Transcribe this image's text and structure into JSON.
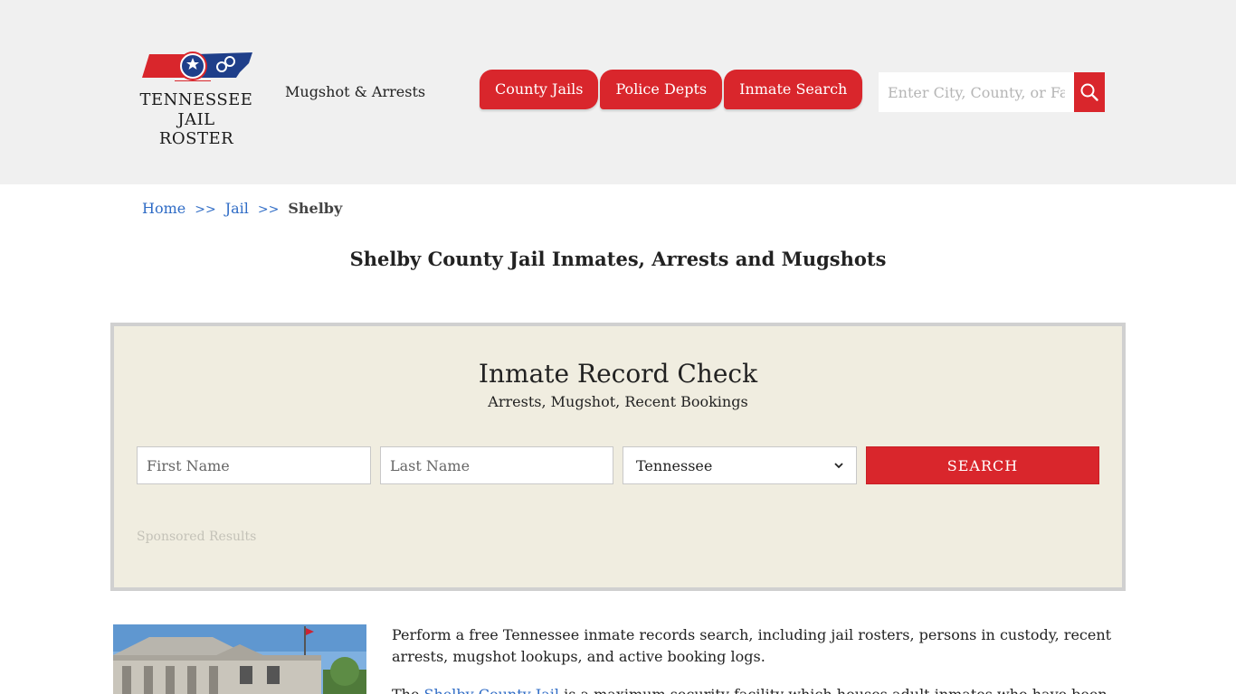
{
  "header": {
    "logo": {
      "line1": "TENNESSEE",
      "line2": "JAIL ROSTER",
      "icon": "tennessee-map-logo"
    },
    "tagline": "Mugshot & Arrests",
    "nav": [
      {
        "label": "County Jails"
      },
      {
        "label": "Police Depts"
      },
      {
        "label": "Inmate Search"
      }
    ],
    "search": {
      "placeholder": "Enter City, County, or Facil",
      "icon": "search-icon"
    }
  },
  "breadcrumb": {
    "home": "Home",
    "sep": ">>",
    "jail": "Jail",
    "current": "Shelby"
  },
  "page_title": "Shelby County Jail Inmates, Arrests and Mugshots",
  "record_check": {
    "title": "Inmate Record Check",
    "subtitle": "Arrests, Mugshot, Recent Bookings",
    "first_name_placeholder": "First Name",
    "last_name_placeholder": "Last Name",
    "state_selected": "Tennessee",
    "search_label": "SEARCH",
    "sponsored": "Sponsored Results"
  },
  "content": {
    "intro": "Perform a free Tennessee inmate records search, including jail rosters, persons in custody, recent arrests, mugshot lookups, and active booking logs.",
    "intro2_prefix": "The ",
    "intro2_link": "Shelby County Jail",
    "intro2_suffix": " is a maximum security facility which houses adult inmates who have been"
  },
  "colors": {
    "accent": "#d9262c",
    "link": "#2f6cc6",
    "header_bg": "#f0f0f0",
    "box_bg": "#f0ede0"
  }
}
